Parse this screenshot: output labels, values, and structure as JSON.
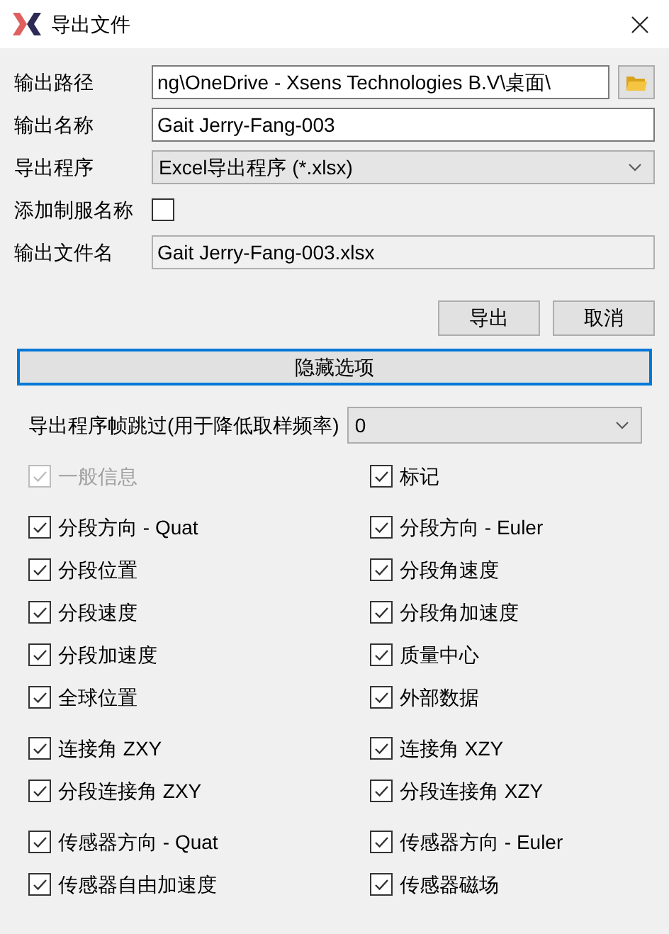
{
  "window": {
    "title": "导出文件"
  },
  "form": [
    {
      "kind": "path",
      "label": "输出路径",
      "value": "ng\\OneDrive - Xsens Technologies B.V\\桌面\\"
    },
    {
      "kind": "text",
      "label": "输出名称",
      "value": "Gait Jerry-Fang-003"
    },
    {
      "kind": "select",
      "label": "导出程序",
      "value": "Excel导出程序 (*.xlsx)"
    },
    {
      "kind": "checkbox",
      "label": "添加制服名称",
      "checked": false
    },
    {
      "kind": "readonly",
      "label": "输出文件名",
      "value": "Gait Jerry-Fang-003.xlsx"
    }
  ],
  "buttons": [
    "导出",
    "取消"
  ],
  "toggle_button": {
    "label": "隐藏选项",
    "focused": true
  },
  "frame_skip": {
    "label": "导出程序帧跳过(用于降低取样频率)",
    "value": "0"
  },
  "option_groups": [
    {
      "items": [
        {
          "label": "一般信息",
          "checked": true,
          "disabled": true
        },
        {
          "label": "标记",
          "checked": true,
          "disabled": false
        }
      ]
    },
    {
      "items": [
        {
          "label": "分段方向 - Quat",
          "checked": true,
          "disabled": false
        },
        {
          "label": "分段方向 - Euler",
          "checked": true,
          "disabled": false
        },
        {
          "label": "分段位置",
          "checked": true,
          "disabled": false
        },
        {
          "label": "分段角速度",
          "checked": true,
          "disabled": false
        },
        {
          "label": "分段速度",
          "checked": true,
          "disabled": false
        },
        {
          "label": "分段角加速度",
          "checked": true,
          "disabled": false
        },
        {
          "label": "分段加速度",
          "checked": true,
          "disabled": false
        },
        {
          "label": "质量中心",
          "checked": true,
          "disabled": false
        },
        {
          "label": "全球位置",
          "checked": true,
          "disabled": false
        },
        {
          "label": "外部数据",
          "checked": true,
          "disabled": false
        }
      ]
    },
    {
      "items": [
        {
          "label": "连接角 ZXY",
          "checked": true,
          "disabled": false
        },
        {
          "label": "连接角 XZY",
          "checked": true,
          "disabled": false
        },
        {
          "label": "分段连接角 ZXY",
          "checked": true,
          "disabled": false
        },
        {
          "label": "分段连接角 XZY",
          "checked": true,
          "disabled": false
        }
      ]
    },
    {
      "items": [
        {
          "label": "传感器方向 - Quat",
          "checked": true,
          "disabled": false
        },
        {
          "label": "传感器方向 - Euler",
          "checked": true,
          "disabled": false
        },
        {
          "label": "传感器自由加速度",
          "checked": true,
          "disabled": false
        },
        {
          "label": "传感器磁场",
          "checked": true,
          "disabled": false
        }
      ]
    }
  ]
}
